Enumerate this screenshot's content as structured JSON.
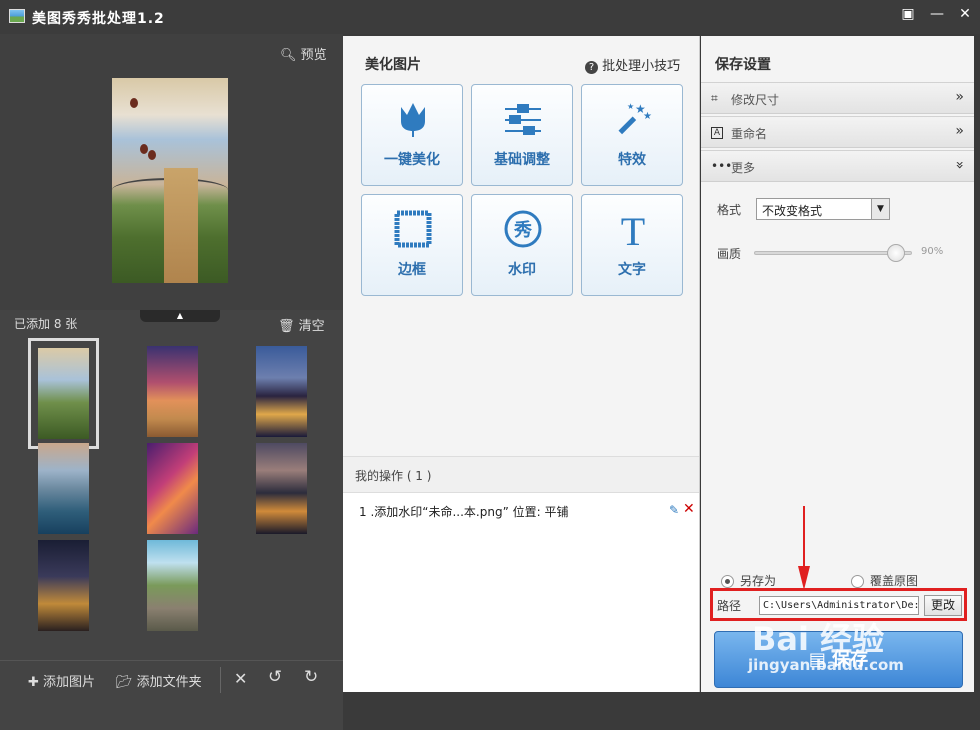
{
  "window": {
    "title": "美图秀秀批处理1.2"
  },
  "left": {
    "preview_label": "预览",
    "added_count": "已添加 8 张",
    "clear_label": "清空",
    "add_image_label": "添加图片",
    "add_folder_label": "添加文件夹"
  },
  "center": {
    "section_title": "美化图片",
    "tips_label": "批处理小技巧",
    "tools": [
      {
        "label": "一键美化",
        "icon": "tulip-icon"
      },
      {
        "label": "基础调整",
        "icon": "sliders-icon"
      },
      {
        "label": "特效",
        "icon": "magic-wand-icon"
      },
      {
        "label": "边框",
        "icon": "frame-icon"
      },
      {
        "label": "水印",
        "icon": "seal-icon"
      },
      {
        "label": "文字",
        "icon": "text-icon"
      }
    ],
    "ops_title": "我的操作 ( 1 )",
    "ops": [
      {
        "text": "1 .添加水印“未命...本.png” 位置: 平铺"
      }
    ]
  },
  "right": {
    "title": "保存设置",
    "resize_label": "修改尺寸",
    "rename_label": "重命名",
    "more_label": "更多",
    "format_label": "格式",
    "format_value": "不改变格式",
    "quality_label": "画质",
    "quality_value": "90%",
    "quality_level": 0.9,
    "save_as_label": "另存为",
    "overwrite_label": "覆盖原图",
    "path_label": "路径",
    "path_value": "C:\\Users\\Administrator\\De:",
    "change_label": "更改",
    "save_label": "保存"
  },
  "watermark": {
    "text": "Bai 经验",
    "url": "jingyan.baidu.com"
  },
  "colors": {
    "accent": "#2f7bbf",
    "highlight": "#e02020",
    "save_button": "#4f97e0"
  }
}
